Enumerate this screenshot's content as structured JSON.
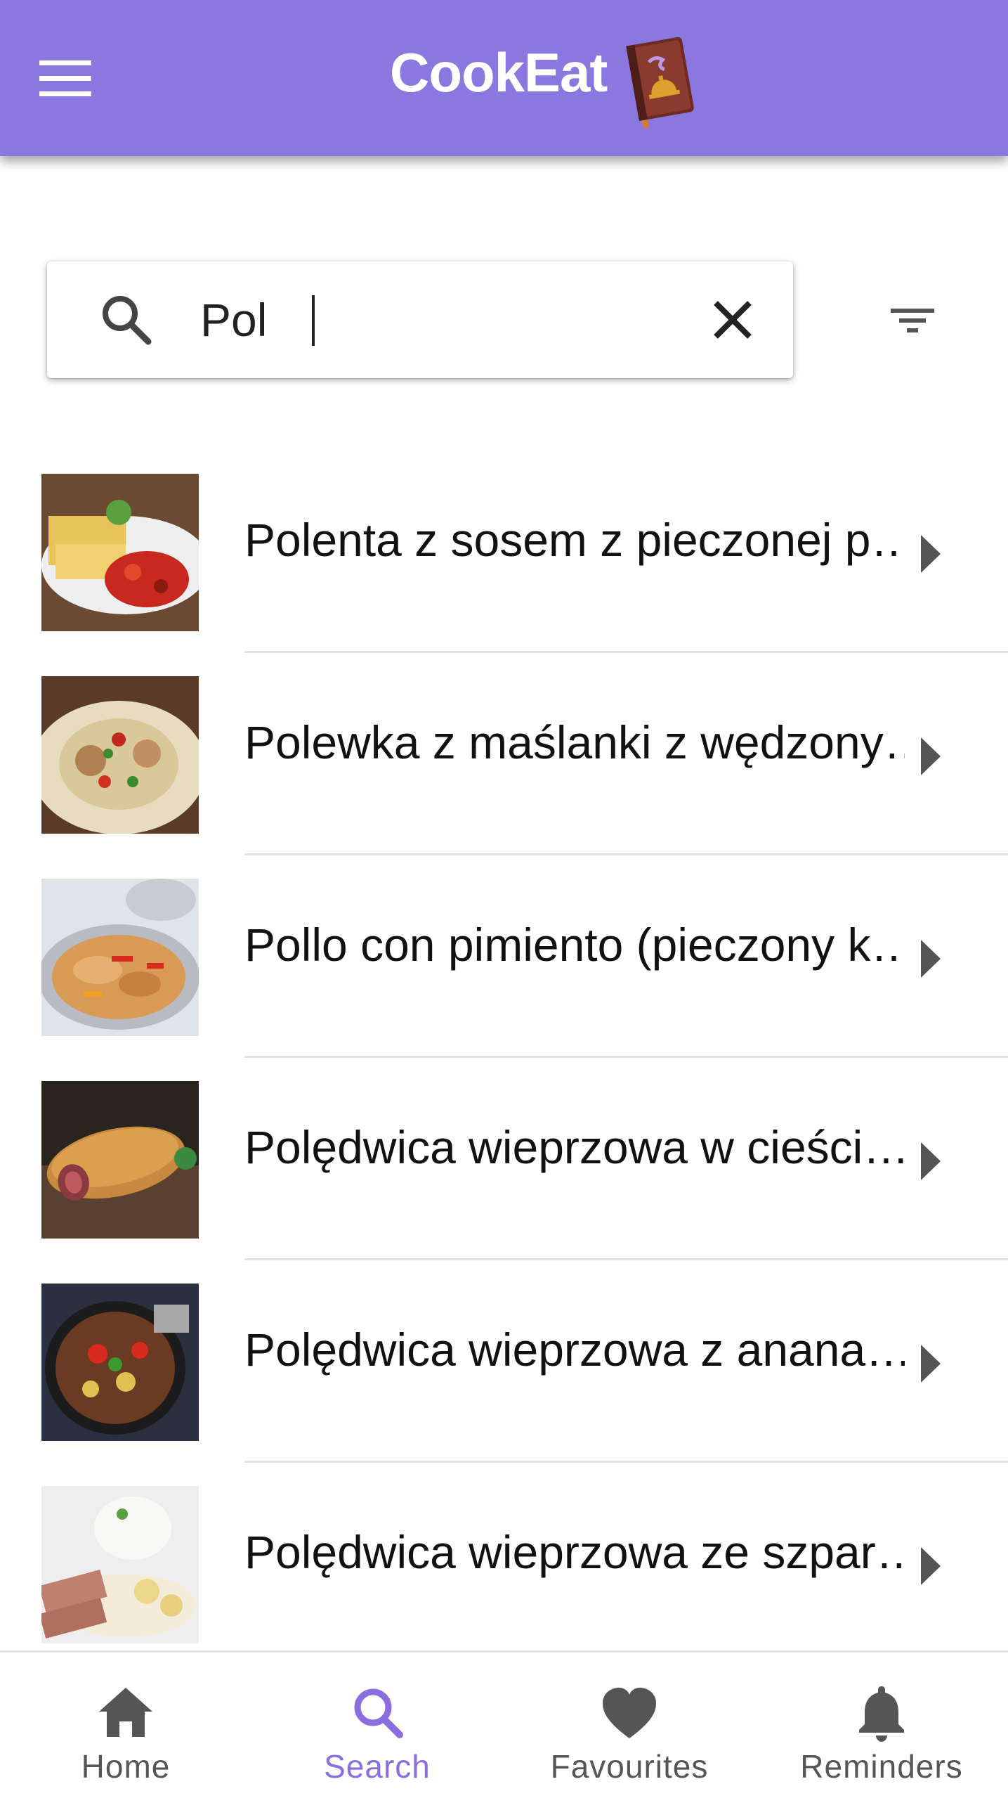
{
  "app": {
    "title": "CookEat",
    "accent_color": "#8a78e0",
    "menu_icon": "hamburger-menu-icon",
    "logo_icon": "cookbook-logo-icon"
  },
  "search": {
    "value": "Pol",
    "search_icon": "search-icon",
    "clear_icon": "close-icon",
    "filter_icon": "filter-icon"
  },
  "results": [
    {
      "label": "Polenta z sosem z pieczonej p…"
    },
    {
      "label": "Polewka z maślanki z wędzony…"
    },
    {
      "label": "Pollo con pimiento (pieczony k…"
    },
    {
      "label": "Polędwica wieprzowa w cieści…"
    },
    {
      "label": "Polędwica wieprzowa z anana…"
    },
    {
      "label": "Polędwica wieprzowa ze szpar…"
    }
  ],
  "bottom_nav": {
    "active_color": "#8a6ee0",
    "items": [
      {
        "label": "Home",
        "icon": "home-icon"
      },
      {
        "label": "Search",
        "icon": "search-icon"
      },
      {
        "label": "Favourites",
        "icon": "heart-icon"
      },
      {
        "label": "Reminders",
        "icon": "bell-icon"
      }
    ]
  }
}
